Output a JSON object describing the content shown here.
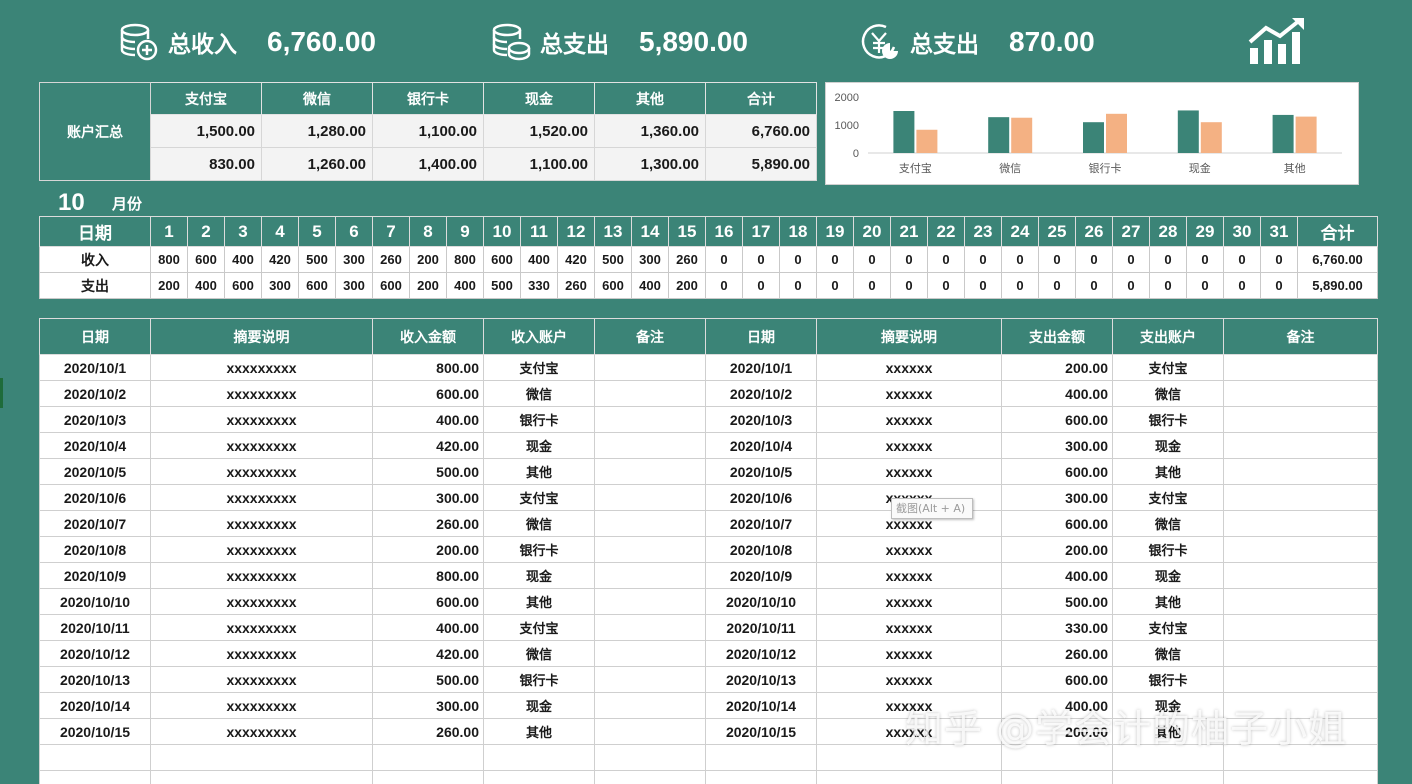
{
  "kpis": [
    {
      "label": "总收入",
      "value": "6,760.00",
      "icon": "coins-plus-icon"
    },
    {
      "label": "总支出",
      "value": "5,890.00",
      "icon": "coins-minus-icon"
    },
    {
      "label": "总支出",
      "value": "870.00",
      "icon": "yen-pie-icon"
    }
  ],
  "summary": {
    "row_label": "账户汇总",
    "columns": [
      "支付宝",
      "微信",
      "银行卡",
      "现金",
      "其他",
      "合计"
    ],
    "income": [
      "1,500.00",
      "1,280.00",
      "1,100.00",
      "1,520.00",
      "1,360.00",
      "6,760.00"
    ],
    "expense": [
      "830.00",
      "1,260.00",
      "1,400.00",
      "1,100.00",
      "1,300.00",
      "5,890.00"
    ]
  },
  "chart_data": {
    "type": "bar",
    "categories": [
      "支付宝",
      "微信",
      "银行卡",
      "现金",
      "其他"
    ],
    "series": [
      {
        "values": [
          1500,
          1280,
          1100,
          1520,
          1360
        ]
      },
      {
        "values": [
          830,
          1260,
          1400,
          1100,
          1300
        ]
      }
    ],
    "y_ticks": [
      "2000",
      "1000",
      "0"
    ],
    "ylim": [
      0,
      2000
    ],
    "colors": [
      "#3b8477",
      "#f4b183"
    ],
    "grid": false
  },
  "month": {
    "number": "10",
    "label": "月份"
  },
  "daily": {
    "date_label": "日期",
    "days": [
      "1",
      "2",
      "3",
      "4",
      "5",
      "6",
      "7",
      "8",
      "9",
      "10",
      "11",
      "12",
      "13",
      "14",
      "15",
      "16",
      "17",
      "18",
      "19",
      "20",
      "21",
      "22",
      "23",
      "24",
      "25",
      "26",
      "27",
      "28",
      "29",
      "30",
      "31"
    ],
    "total_label": "合计",
    "income_label": "收入",
    "expense_label": "支出",
    "income": [
      "800",
      "600",
      "400",
      "420",
      "500",
      "300",
      "260",
      "200",
      "800",
      "600",
      "400",
      "420",
      "500",
      "300",
      "260",
      "0",
      "0",
      "0",
      "0",
      "0",
      "0",
      "0",
      "0",
      "0",
      "0",
      "0",
      "0",
      "0",
      "0",
      "0",
      "0"
    ],
    "expense": [
      "200",
      "400",
      "600",
      "300",
      "600",
      "300",
      "600",
      "200",
      "400",
      "500",
      "330",
      "260",
      "600",
      "400",
      "200",
      "0",
      "0",
      "0",
      "0",
      "0",
      "0",
      "0",
      "0",
      "0",
      "0",
      "0",
      "0",
      "0",
      "0",
      "0",
      "0"
    ],
    "income_total": "6,760.00",
    "expense_total": "5,890.00"
  },
  "detail": {
    "headers": [
      "日期",
      "摘要说明",
      "收入金额",
      "收入账户",
      "备注",
      "日期",
      "摘要说明",
      "支出金额",
      "支出账户",
      "备注"
    ],
    "rows": [
      [
        "2020/10/1",
        "xxxxxxxxx",
        "800.00",
        "支付宝",
        "",
        "2020/10/1",
        "xxxxxx",
        "200.00",
        "支付宝",
        ""
      ],
      [
        "2020/10/2",
        "xxxxxxxxx",
        "600.00",
        "微信",
        "",
        "2020/10/2",
        "xxxxxx",
        "400.00",
        "微信",
        ""
      ],
      [
        "2020/10/3",
        "xxxxxxxxx",
        "400.00",
        "银行卡",
        "",
        "2020/10/3",
        "xxxxxx",
        "600.00",
        "银行卡",
        ""
      ],
      [
        "2020/10/4",
        "xxxxxxxxx",
        "420.00",
        "现金",
        "",
        "2020/10/4",
        "xxxxxx",
        "300.00",
        "现金",
        ""
      ],
      [
        "2020/10/5",
        "xxxxxxxxx",
        "500.00",
        "其他",
        "",
        "2020/10/5",
        "xxxxxx",
        "600.00",
        "其他",
        ""
      ],
      [
        "2020/10/6",
        "xxxxxxxxx",
        "300.00",
        "支付宝",
        "",
        "2020/10/6",
        "xxxxxx",
        "300.00",
        "支付宝",
        ""
      ],
      [
        "2020/10/7",
        "xxxxxxxxx",
        "260.00",
        "微信",
        "",
        "2020/10/7",
        "xxxxxx",
        "600.00",
        "微信",
        ""
      ],
      [
        "2020/10/8",
        "xxxxxxxxx",
        "200.00",
        "银行卡",
        "",
        "2020/10/8",
        "xxxxxx",
        "200.00",
        "银行卡",
        ""
      ],
      [
        "2020/10/9",
        "xxxxxxxxx",
        "800.00",
        "现金",
        "",
        "2020/10/9",
        "xxxxxx",
        "400.00",
        "现金",
        ""
      ],
      [
        "2020/10/10",
        "xxxxxxxxx",
        "600.00",
        "其他",
        "",
        "2020/10/10",
        "xxxxxx",
        "500.00",
        "其他",
        ""
      ],
      [
        "2020/10/11",
        "xxxxxxxxx",
        "400.00",
        "支付宝",
        "",
        "2020/10/11",
        "xxxxxx",
        "330.00",
        "支付宝",
        ""
      ],
      [
        "2020/10/12",
        "xxxxxxxxx",
        "420.00",
        "微信",
        "",
        "2020/10/12",
        "xxxxxx",
        "260.00",
        "微信",
        ""
      ],
      [
        "2020/10/13",
        "xxxxxxxxx",
        "500.00",
        "银行卡",
        "",
        "2020/10/13",
        "xxxxxx",
        "600.00",
        "银行卡",
        ""
      ],
      [
        "2020/10/14",
        "xxxxxxxxx",
        "300.00",
        "现金",
        "",
        "2020/10/14",
        "xxxxxx",
        "400.00",
        "现金",
        ""
      ],
      [
        "2020/10/15",
        "xxxxxxxxx",
        "260.00",
        "其他",
        "",
        "2020/10/15",
        "xxxxxx",
        "200.00",
        "其他",
        ""
      ],
      [
        "",
        "",
        "",
        "",
        "",
        "",
        "",
        "",
        "",
        ""
      ],
      [
        "",
        "",
        "",
        "",
        "",
        "",
        "",
        "",
        "",
        ""
      ]
    ]
  },
  "overlay": {
    "screenshot_tip": "截图(Alt + A)",
    "watermark": "知乎 @学会计的柚子小姐"
  },
  "colors": {
    "theme": "#3b8477",
    "income_bar": "#3b8477",
    "expense_bar": "#f4b183"
  }
}
